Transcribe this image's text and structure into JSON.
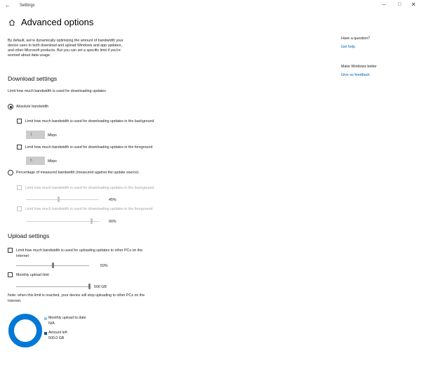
{
  "window": {
    "title": "Settings"
  },
  "header": {
    "title": "Advanced options"
  },
  "intro": {
    "lines": [
      "By default, we're dynamically optimizing the amount of bandwidth your",
      "device uses to both download and upload Windows and app updates,",
      "and other Microsoft products. But you can set a specific limit if you're",
      "worried about data usage."
    ]
  },
  "download": {
    "heading": "Download settings",
    "subheading": "Limit how much bandwidth is used for downloading updates",
    "absolute": {
      "label": "Absolute bandwidth",
      "selected": true,
      "background": {
        "label": "Limit how much bandwidth is used for downloading updates in the background",
        "value": "1",
        "unit": "Mbps"
      },
      "foreground": {
        "label": "Limit how much bandwidth is used for downloading updates in the foreground",
        "value": "5",
        "unit": "Mbps"
      }
    },
    "percentage": {
      "label": "Percentage of measured bandwidth (measured against the update source)",
      "selected": false,
      "background": {
        "label": "Limit how much bandwidth is used for downloading updates in the background",
        "value": "45%",
        "level": 0.45
      },
      "foreground": {
        "label": "Limit how much bandwidth is used for downloading updates in the foreground",
        "value": "90%",
        "level": 0.9
      }
    }
  },
  "upload": {
    "heading": "Upload settings",
    "limit": {
      "label_line1": "Limit how much bandwidth is used for uploading updates to other PCs on the",
      "label_line2": "Internet",
      "value": "50%",
      "level": 0.5
    },
    "monthly": {
      "label": "Monthly upload limit",
      "value": "500 GB",
      "level": 1.0
    },
    "note_line1": "Note: when this limit is reached, your device will stop uploading to other PCs on the",
    "note_line2": "Internet.",
    "legend": {
      "uploaded_label": "Monthly upload to date",
      "uploaded_value": "N/A",
      "left_label": "Amount left",
      "left_value": "500.0 GB"
    },
    "colors": {
      "ring": "#0078d7",
      "uploaded": "#8fc6ea",
      "left": "#005a9e"
    }
  },
  "sidebar": {
    "question_title": "Have a question?",
    "help_link": "Get help",
    "better_title": "Make Windows better",
    "feedback_link": "Give us feedback"
  }
}
